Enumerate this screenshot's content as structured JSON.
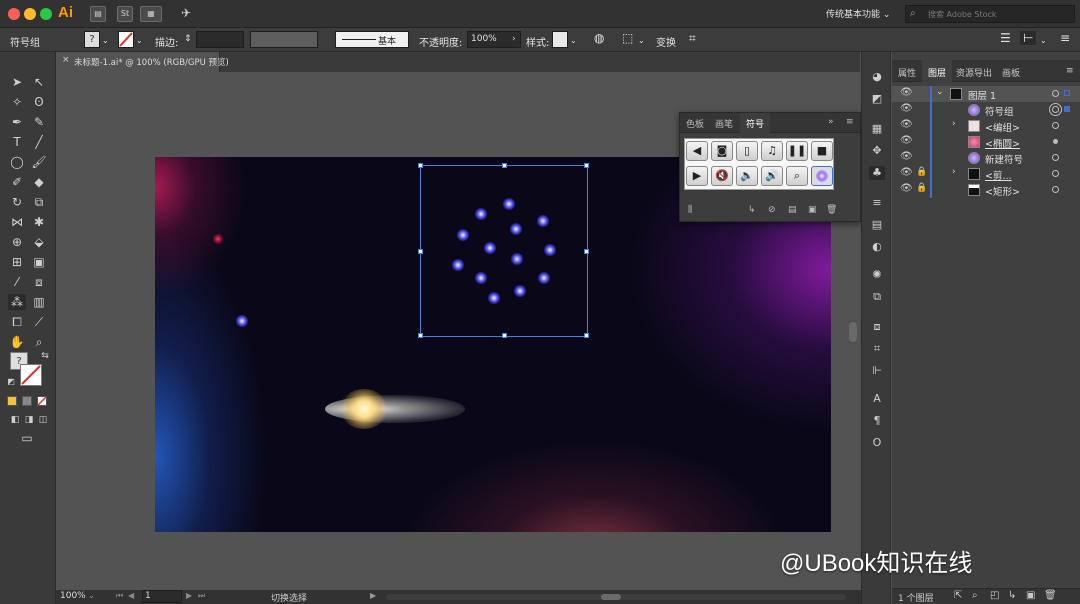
{
  "app": {
    "logo": "Ai",
    "workspace": "传统基本功能",
    "stock_placeholder": "搜索 Adobe Stock"
  },
  "control_bar": {
    "selection_label": "符号组",
    "stroke_label": "描边:",
    "stroke_style": "基本",
    "opacity_label": "不透明度:",
    "opacity_value": "100%",
    "style_label": "样式:",
    "transform_label": "变换"
  },
  "document": {
    "tab_title": "未标题-1.ai* @ 100% (RGB/GPU 预览)",
    "close_glyph": "×"
  },
  "symbols_panel": {
    "tabs": [
      "色板",
      "画笔",
      "符号"
    ],
    "active_tab": "符号",
    "symbols": [
      "arrow-left",
      "camera",
      "film",
      "music-note",
      "pause",
      "stop",
      "play",
      "mute",
      "volume-low",
      "volume-high",
      "magnifier",
      "new-symbol-glow"
    ]
  },
  "layers_panel": {
    "tabs": [
      "属性",
      "图层",
      "资源导出",
      "画板"
    ],
    "active_tab": "图层",
    "rows": [
      {
        "name": "图层 1",
        "level": 0,
        "expanded": true,
        "locked": false
      },
      {
        "name": "符号组",
        "level": 1,
        "expanded": false,
        "locked": false
      },
      {
        "name": "<编组>",
        "level": 1,
        "expanded": false,
        "locked": false
      },
      {
        "name": "<椭圆>",
        "level": 1,
        "expanded": false,
        "locked": false
      },
      {
        "name": "新建符号",
        "level": 1,
        "expanded": false,
        "locked": false
      },
      {
        "name": "<剪...",
        "level": 1,
        "expanded": false,
        "locked": true
      },
      {
        "name": "<矩形>",
        "level": 1,
        "expanded": false,
        "locked": true
      }
    ],
    "status": "1 个图层"
  },
  "status_bar": {
    "zoom": "100%",
    "artboard": "1",
    "mode": "切换选择"
  },
  "watermark": "@UBook知识在线",
  "colors": {
    "accent": "#3f6fd0",
    "app_bg": "#535353",
    "logo": "#ff9a00"
  }
}
